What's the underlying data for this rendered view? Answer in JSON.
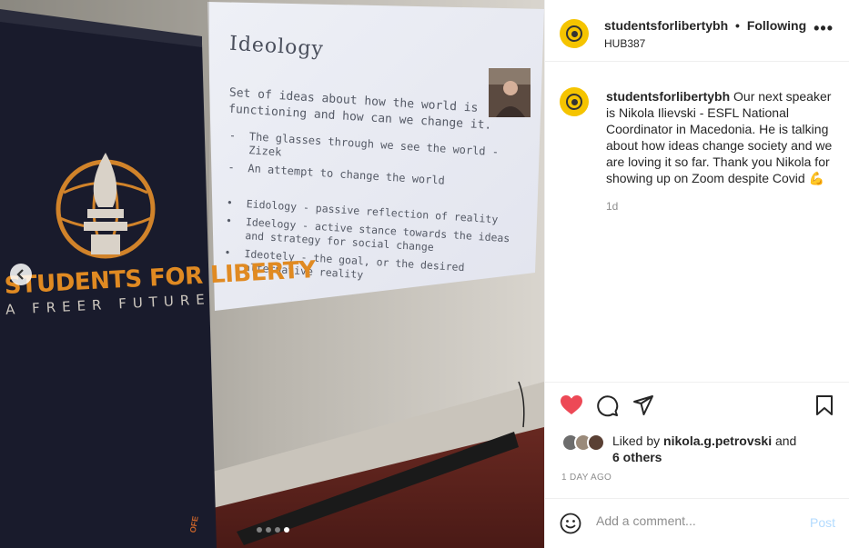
{
  "post": {
    "username": "studentsforlibertybh",
    "separator": "•",
    "follow_label": "Following",
    "location": "HUB387",
    "more_label": "•••",
    "caption_text": "Our next speaker is Nikola Ilievski - ESFL National Coordinator in Macedonia. He is talking about how ideas change society and we are loving it so far. Thank you Nikola for showing up on Zoom despite Covid 💪",
    "age": "1d",
    "liked_by_prefix": "Liked by ",
    "liked_by_user": "nikola.g.petrovski",
    "liked_by_and": " and",
    "liked_by_others": "6 others",
    "date": "1 DAY AGO",
    "comment_placeholder": "Add a comment...",
    "post_label": "Post"
  },
  "photo": {
    "banner_title": "STUDENTS FOR LIBERTY",
    "banner_subtitle": "A FREER FUTURE",
    "banner_footer": "OFE",
    "slide": {
      "title": "Ideology",
      "intro": "Set of ideas about how the world is functioning and how can we change it.",
      "dash_items": [
        {
          "mark": "-",
          "text": "The glasses through we see the world - Zizek"
        },
        {
          "mark": "-",
          "text": "An attempt to change the world"
        }
      ],
      "bullet_items": [
        {
          "mark": "•",
          "text": "Eidology - passive reflection of reality"
        },
        {
          "mark": "•",
          "text": "Ideelogy - active stance towards the ideas and strategy for social change"
        },
        {
          "mark": "•",
          "text": "Ideotely - the goal, or the desired alternative reality"
        }
      ]
    },
    "carousel": {
      "count": 4,
      "active_index": 4
    }
  },
  "colors": {
    "like": "#ed4956",
    "brand_yellow": "#f5c400",
    "banner_orange": "#e08a22",
    "post_disabled": "#b3dbff"
  },
  "icons": [
    "chevron-left-icon",
    "heart-icon",
    "comment-icon",
    "share-icon",
    "bookmark-icon",
    "emoji-icon",
    "more-icon"
  ]
}
